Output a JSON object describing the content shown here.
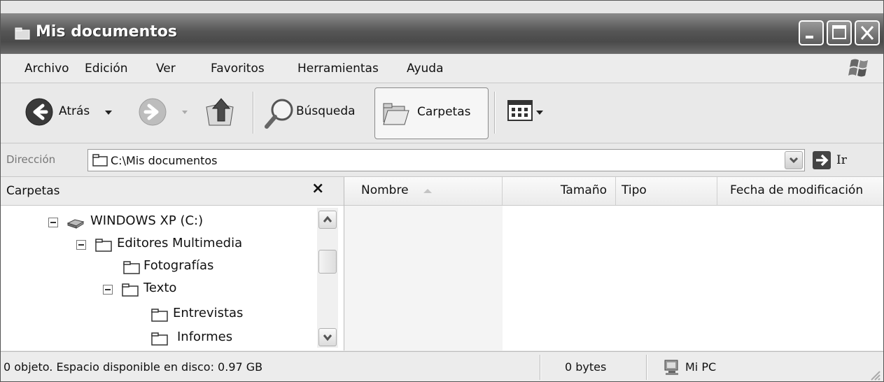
{
  "window": {
    "title": "Mis documentos"
  },
  "menu": [
    "Archivo",
    "Edición",
    "Ver",
    "Favoritos",
    "Herramientas",
    "Ayuda"
  ],
  "toolbar": {
    "back": "Atrás",
    "search": "Búsqueda",
    "folders": "Carpetas"
  },
  "address": {
    "label": "Dirección",
    "value": "C:\\Mis documentos",
    "go": "Ir"
  },
  "folders_pane": {
    "title": "Carpetas",
    "close": "×",
    "tree": [
      {
        "label": "WINDOWS XP (C:)",
        "icon": "drive-icon"
      },
      {
        "label": "Editores Multimedia",
        "icon": "folder-icon"
      },
      {
        "label": "Fotografías",
        "icon": "folder-icon"
      },
      {
        "label": "Texto",
        "icon": "folder-icon"
      },
      {
        "label": "Entrevistas",
        "icon": "folder-icon"
      },
      {
        "label": "Informes",
        "icon": "folder-icon"
      }
    ]
  },
  "columns": [
    "Nombre",
    "Tamaño",
    "Tipo",
    "Fecha de modificación"
  ],
  "status": {
    "info": "0 objeto. Espacio disponible en disco: 0.97 GB",
    "size": "0 bytes",
    "location": "Mi PC"
  }
}
